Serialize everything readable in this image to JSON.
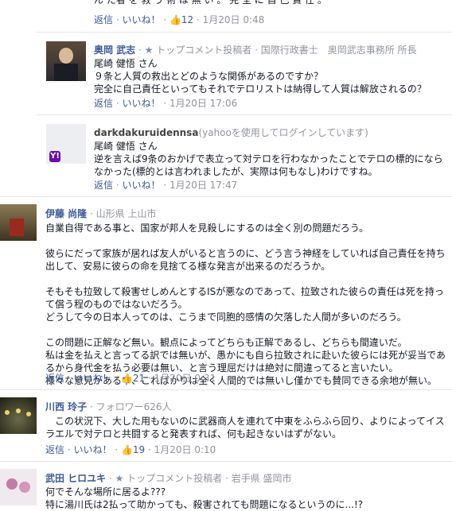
{
  "top_comment": {
    "text_tail": "ん た者 を 救 う 術 は 無 い 。 完 全 に 自 己 責 任 。",
    "reply": "返信",
    "like": "いいね！",
    "likes": "12",
    "time": "1月20日 0:48"
  },
  "reply1": {
    "name": "奥岡 武志",
    "badge": "トップコメント投稿者",
    "meta": "国際行政書士　奥岡武志事務所 所長",
    "lines": [
      "尾崎 健悟 さん",
      "９条と人質の救出とどのような関係があるのですか？",
      "完全に自己責任といってもそれでテロリストは納得して人質は解放されるの？"
    ],
    "reply": "返信",
    "like": "いいね！",
    "time": "1月20日 17:06"
  },
  "reply2": {
    "name": "darkdakuruidennsa",
    "meta": "(yahooを使用してログインしています)",
    "lines": [
      "尾崎 健悟 さん",
      "逆を言えば9条のおかげで表立って対テロを行わなかったことでテロの標的になら",
      "なかった(標的とは言われましたが、実際は何もなし)わけですね。"
    ],
    "reply": "返信",
    "like": "いいね！",
    "time": "1月20日 17:47"
  },
  "comment3": {
    "name": "伊藤 尚隆",
    "meta": "山形県 上山市",
    "lines": [
      "自業自得である事と、国家が邦人を見殺しにするのは全く別の問題だろう。",
      "",
      "彼らにだって家族が居れば友人がいると言うのに、どう言う神経をしていれば自己責任を持ち",
      "出して、安易に彼らの命を見捨てる様な発言が出来るのだろうか。",
      "",
      "そもそも拉致して殺害せしめんとするISが悪なのであって、拉致された彼らの責任は死を持っ",
      "て償う程のものではないだろう。",
      "どうして今の日本人ってのは、こうまで同胞的感情の欠落した人間が多いのだろう。",
      "",
      "この問題に正解など無い。観点によってどちらも正解であるし、どちらも間違いだ。",
      "私は金を払えと言ってる訳では無いが、愚かにも自ら拉致されに赴いた彼らには死が妥当であ",
      "るから身代金を払う必要は無い、と言う理屈だけは絶対に間違ってると言いたい。",
      "様々な意見がある中、こればかりは全く人間的では無いし僅かでも賛同できる余地が無い。"
    ],
    "reply": "返信",
    "like": "いいね！",
    "likes": "21",
    "time": "1月20日 0:31"
  },
  "comment4": {
    "name": "川西 玲子",
    "meta": "フォロワー626人",
    "lines": [
      "　この状況下、大した用もないのに武器商人を連れて中東をふらふら回り、よりによってイス",
      "ラエルで対テロと共闘すると発表すれば、何も起きないはずがない。"
    ],
    "reply": "返信",
    "like": "いいね！",
    "likes": "19",
    "time": "1月20日 0:10"
  },
  "comment5": {
    "name": "武田 ヒロユキ",
    "badge": "トップコメント投稿者",
    "meta": "岩手県 盛岡市",
    "lines": [
      "何でそんな場所に居るよ???",
      "特に湯川氏は2払って助かっても、殺害されても問題になるというのに...!?"
    ]
  },
  "colors": {
    "link": "#3b5998",
    "meta": "#90949c",
    "text": "#141823"
  }
}
